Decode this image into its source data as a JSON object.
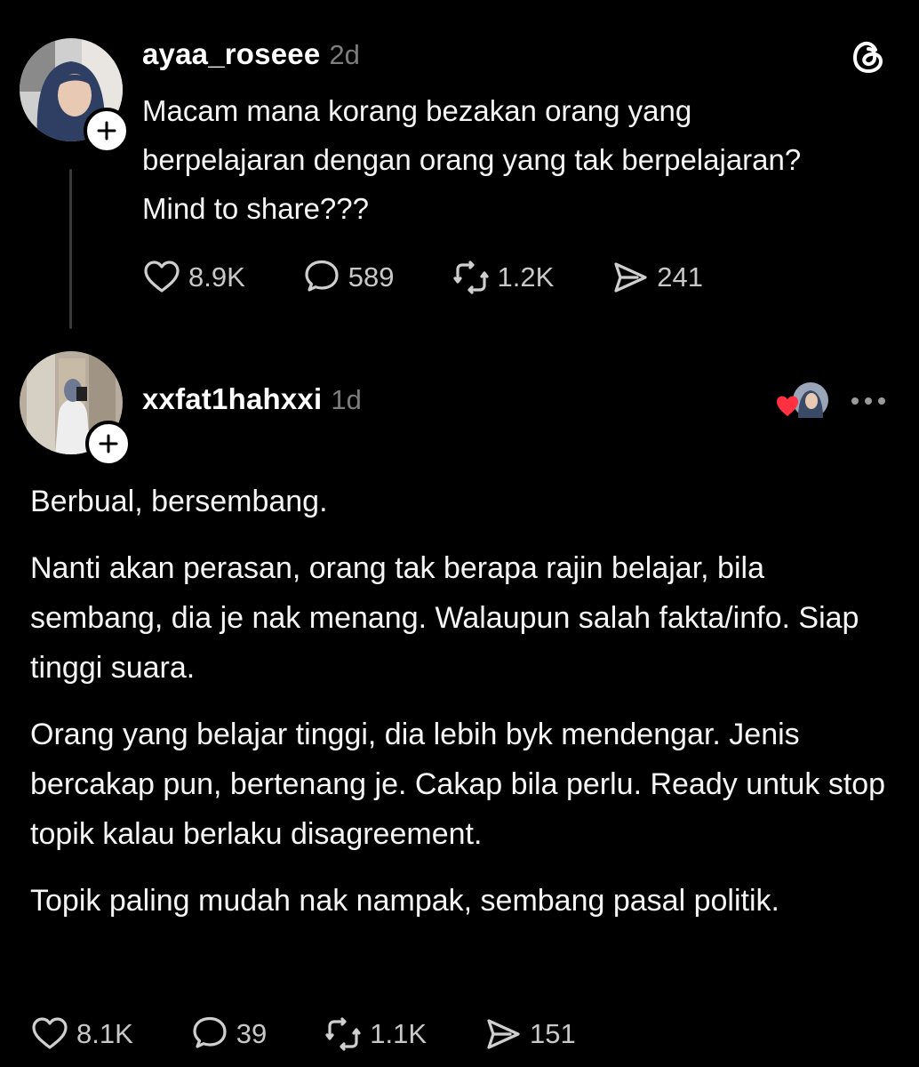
{
  "post": {
    "username": "ayaa_roseee",
    "time": "2d",
    "text": "Macam mana korang bezakan orang yang berpelajaran dengan orang yang tak berpelajaran? Mind to share???",
    "stats": {
      "likes": "8.9K",
      "replies": "589",
      "reposts": "1.2K",
      "shares": "241"
    }
  },
  "reply": {
    "username": "xxfat1hahxxi",
    "time": "1d",
    "paragraphs": [
      "Berbual, bersembang.",
      "Nanti akan perasan, orang tak berapa rajin belajar, bila sembang, dia je nak menang. Walaupun salah fakta/info. Siap tinggi suara.",
      "Orang yang belajar tinggi, dia lebih byk mendengar. Jenis bercakap pun, bertenang je. Cakap bila perlu. Ready untuk stop topik kalau berlaku disagreement.",
      "Topik paling mudah nak nampak, sembang pasal politik."
    ],
    "stats": {
      "likes": "8.1K",
      "replies": "39",
      "reposts": "1.1K",
      "shares": "151"
    }
  },
  "icons": {
    "app_logo": "threads-icon",
    "like": "heart-icon",
    "reply": "comment-icon",
    "repost": "repost-icon",
    "share": "send-icon",
    "follow": "plus-icon",
    "more": "more-horizontal-icon"
  },
  "colors": {
    "background": "#000000",
    "text": "#f5f5f5",
    "muted": "#7d7d7d",
    "like_heart": "#ff3040"
  }
}
